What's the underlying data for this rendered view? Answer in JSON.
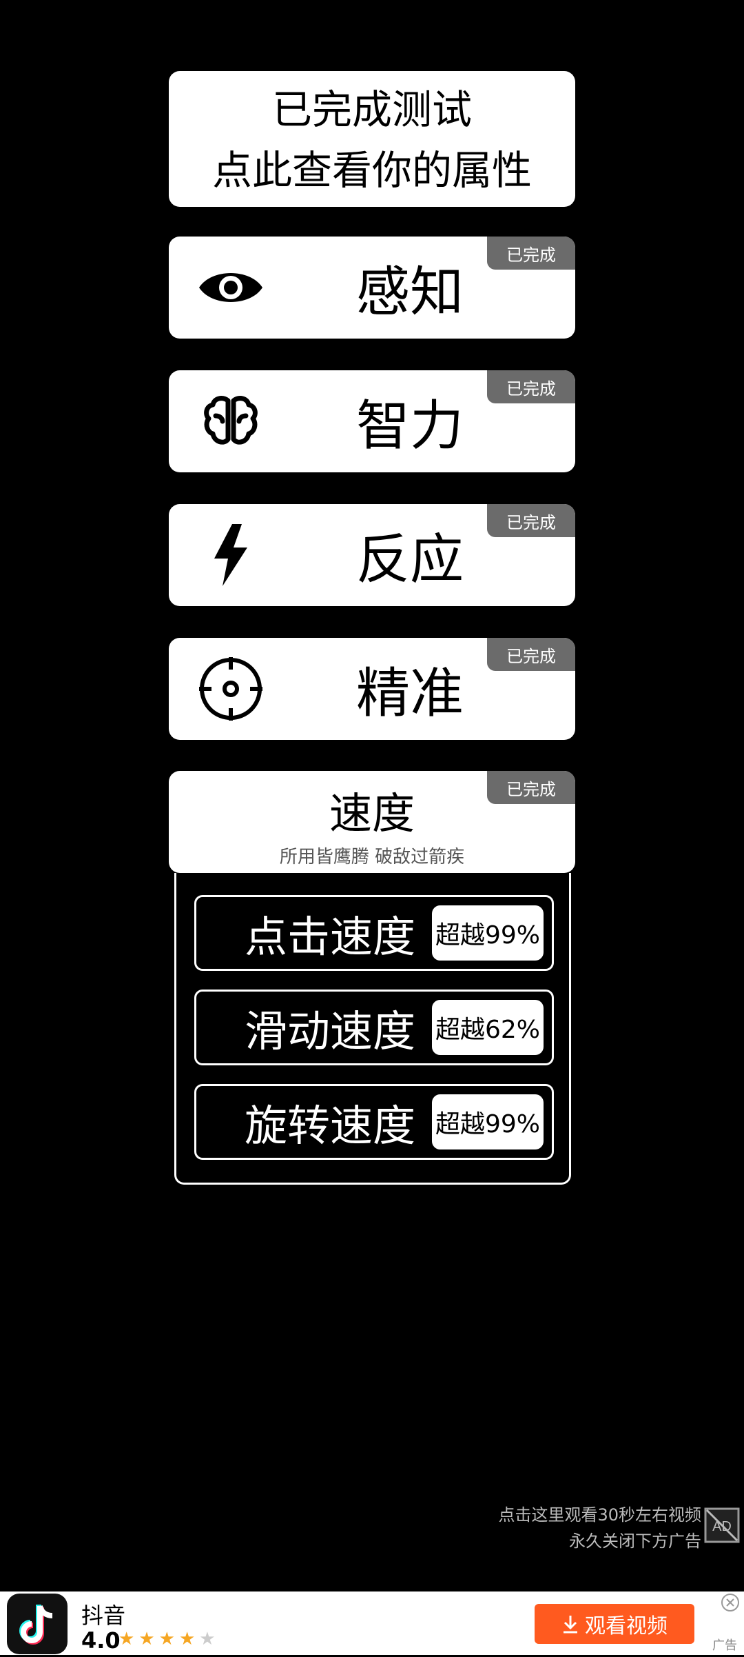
{
  "top_card": {
    "line1": "已完成测试",
    "line2": "点此查看你的属性"
  },
  "categories": [
    {
      "label": "感知",
      "icon": "eye-icon",
      "badge": "已完成"
    },
    {
      "label": "智力",
      "icon": "brain-icon",
      "badge": "已完成"
    },
    {
      "label": "反应",
      "icon": "lightning-icon",
      "badge": "已完成"
    },
    {
      "label": "精准",
      "icon": "crosshair-icon",
      "badge": "已完成"
    }
  ],
  "speed": {
    "title": "速度",
    "subtitle": "所用皆鹰腾 破敌过箭疾",
    "badge": "已完成",
    "rows": [
      {
        "label": "点击速度",
        "value": "超越99%"
      },
      {
        "label": "滑动速度",
        "value": "超越62%"
      },
      {
        "label": "旋转速度",
        "value": "超越99%"
      }
    ]
  },
  "ad_notice": {
    "line1": "点击这里观看30秒左右视频",
    "line2": "永久关闭下方广告"
  },
  "bottom_ad": {
    "app_name": "抖音",
    "rating": "4.0",
    "stars_filled": 4,
    "stars_total": 5,
    "button_label": "观看视频",
    "ad_label": "广告",
    "button_color": "#ff5a1f"
  }
}
